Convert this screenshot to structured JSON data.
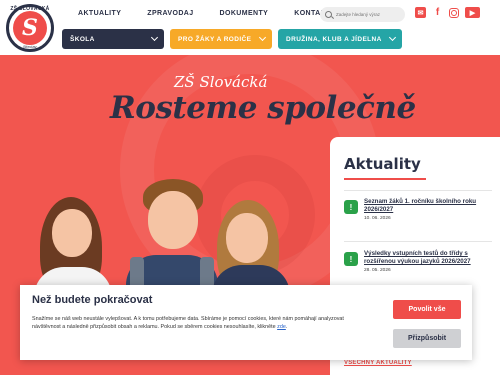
{
  "logo": {
    "ring_text": "ZŠ SLOVÁCKÁ",
    "bottom_text": "Břeclav",
    "mark": "S"
  },
  "topnav": {
    "items": [
      "AKTUALITY",
      "ZPRAVODAJ",
      "DOKUMENTY",
      "KONTAKTY"
    ]
  },
  "search": {
    "placeholder": "Zadejte hledaný výraz"
  },
  "socials": [
    "email-icon",
    "facebook-icon",
    "instagram-icon",
    "youtube-icon"
  ],
  "menu": {
    "items": [
      "ŠKOLA",
      "PRO ŽÁKY A RODIČE",
      "DRUŽINA, KLUB A JÍDELNA"
    ]
  },
  "hero": {
    "school_name": "ZŠ Slovácká",
    "headline": "Rosteme společně"
  },
  "news": {
    "title": "Aktuality",
    "items": [
      {
        "title": "Seznam žáků 1. ročníku školního roku 2026/2027",
        "date": "10. 06. 2026"
      },
      {
        "title": "Výsledky vstupních testů do třídy s rozšířenou výukou jazyků 2026/2027",
        "date": "28. 05. 2026"
      }
    ],
    "all_link": "VŠECHNY AKTUALITY"
  },
  "cookie": {
    "title": "Než budete pokračovat",
    "text": "Snažíme se náš web neustále vylepšovat. A k tomu potřebujeme data. Sbíráme je pomocí cookies, které nám pomáhají analyzovat návštěvnost a následně přizpůsobit obsah a reklamu. Pokud se sběrem cookies nesouhlasíte, klikněte",
    "link": "zde",
    "accept": "Povolit vše",
    "customize": "Přizpůsobit"
  },
  "colors": {
    "brand_red": "#ef4d4a",
    "navy": "#2b3147",
    "orange": "#f7a928",
    "teal": "#25a5a6",
    "green": "#2aa149"
  }
}
